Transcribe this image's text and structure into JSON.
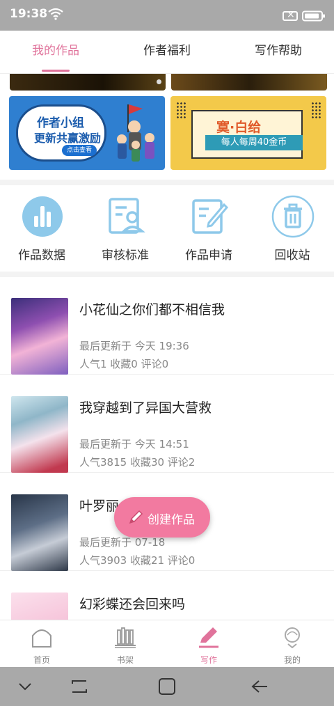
{
  "status_bar": {
    "time": "19:38"
  },
  "tabs": [
    {
      "label": "我的作品",
      "active": true
    },
    {
      "label": "作者福利",
      "active": false
    },
    {
      "label": "写作帮助",
      "active": false
    }
  ],
  "banners": [
    {
      "line1": "作者小组",
      "line2": "更新共赢激励",
      "button": "点击查看"
    },
    {
      "line1": "寞·白给",
      "line2": "每人每周40金币"
    }
  ],
  "actions": [
    {
      "label": "作品数据",
      "icon": "bar-chart-icon"
    },
    {
      "label": "审核标准",
      "icon": "audit-standard-icon"
    },
    {
      "label": "作品申请",
      "icon": "apply-icon"
    },
    {
      "label": "回收站",
      "icon": "trash-icon"
    }
  ],
  "works": [
    {
      "title": "小花仙之你们都不相信我",
      "updated": "最后更新于 今天 19:36",
      "stats": "人气1  收藏0  评论0"
    },
    {
      "title": "我穿越到了异国大营救",
      "updated": "最后更新于 今天 14:51",
      "stats": "人气3815  收藏30  评论2"
    },
    {
      "title": "叶罗丽       生",
      "updated": "最后更新于 07-18",
      "stats": "人气3903  收藏21  评论0"
    },
    {
      "title": "幻彩蝶还会回来吗",
      "updated": "",
      "stats": ""
    }
  ],
  "fab": {
    "label": "创建作品"
  },
  "bottom_nav": [
    {
      "label": "首页",
      "icon": "home-icon",
      "active": false
    },
    {
      "label": "书架",
      "icon": "bookshelf-icon",
      "active": false
    },
    {
      "label": "写作",
      "icon": "pen-icon",
      "active": true
    },
    {
      "label": "我的",
      "icon": "profile-icon",
      "active": false
    }
  ],
  "colors": {
    "accent": "#e0739b",
    "fab": "#f27aa0",
    "icon_blue": "#8ec9ea"
  }
}
